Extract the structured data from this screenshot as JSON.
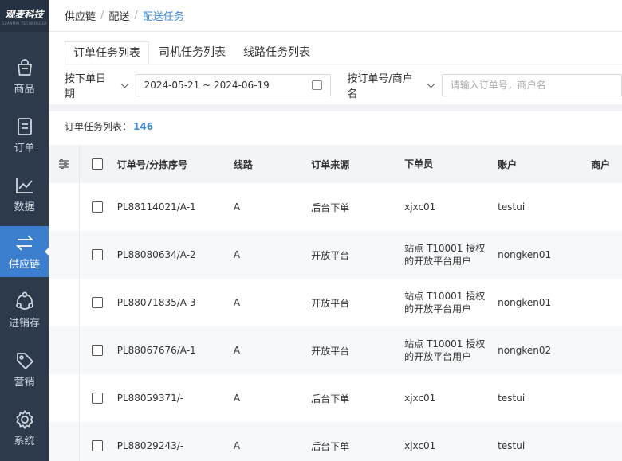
{
  "logo": {
    "text": "观麦科技",
    "sub": "GUANMAI TECHNOLOGY"
  },
  "sidebar": {
    "items": [
      {
        "label": "商品",
        "icon": "shopping-bag-icon"
      },
      {
        "label": "订单",
        "icon": "order-document-icon"
      },
      {
        "label": "数据",
        "icon": "line-chart-icon"
      },
      {
        "label": "供应链",
        "icon": "swap-arrows-icon",
        "active": true
      },
      {
        "label": "进销存",
        "icon": "cycle-nodes-icon"
      },
      {
        "label": "营销",
        "icon": "tag-icon"
      },
      {
        "label": "系统",
        "icon": "gear-icon"
      }
    ]
  },
  "breadcrumb": {
    "items": [
      "供应链",
      "配送",
      "配送任务"
    ],
    "separator": "/"
  },
  "tabs": [
    "订单任务列表",
    "司机任务列表",
    "线路任务列表"
  ],
  "filters": {
    "date_type": "按下单日期",
    "date_range": "2024-05-21 ~ 2024-06-19",
    "search_type": "按订单号/商户名",
    "search_placeholder": "请输入订单号，商户名"
  },
  "list": {
    "title": "订单任务列表：",
    "count": "146"
  },
  "table": {
    "columns": [
      "订单号/分拣序号",
      "线路",
      "订单来源",
      "下单员",
      "账户",
      "商户"
    ],
    "rows": [
      {
        "order": "PL88114021/A-1",
        "route": "A",
        "source": "后台下单",
        "user": "xjxc01",
        "account": "testui"
      },
      {
        "order": "PL88080634/A-2",
        "route": "A",
        "source": "开放平台",
        "user": "站点 T10001 授权的开放平台用户",
        "account": "nongken01"
      },
      {
        "order": "PL88071835/A-3",
        "route": "A",
        "source": "开放平台",
        "user": "站点 T10001 授权的开放平台用户",
        "account": "nongken01"
      },
      {
        "order": "PL88067676/A-1",
        "route": "A",
        "source": "开放平台",
        "user": "站点 T10001 授权的开放平台用户",
        "account": "nongken02"
      },
      {
        "order": "PL88059371/-",
        "route": "A",
        "source": "后台下单",
        "user": "xjxc01",
        "account": "testui"
      },
      {
        "order": "PL88029243/-",
        "route": "A",
        "source": "后台下单",
        "user": "xjxc01",
        "account": "testui"
      }
    ]
  },
  "colors": {
    "sidebar": "#2d3a4c",
    "active": "#3d7fcf",
    "accent": "#3d88d9"
  }
}
